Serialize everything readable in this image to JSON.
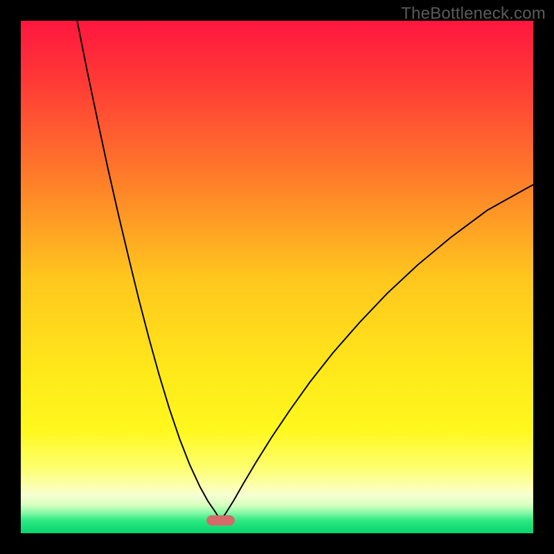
{
  "watermark": "TheBottleneck.com",
  "chart_data": {
    "type": "line",
    "title": "",
    "xlabel": "",
    "ylabel": "",
    "xlim": [
      0,
      1
    ],
    "ylim": [
      0,
      1
    ],
    "background_gradient": {
      "stops": [
        {
          "offset": 0.0,
          "color": "#ff163f"
        },
        {
          "offset": 0.12,
          "color": "#ff3a36"
        },
        {
          "offset": 0.3,
          "color": "#ff7a2a"
        },
        {
          "offset": 0.5,
          "color": "#ffc61e"
        },
        {
          "offset": 0.68,
          "color": "#ffe81a"
        },
        {
          "offset": 0.8,
          "color": "#fff81e"
        },
        {
          "offset": 0.87,
          "color": "#fdff6a"
        },
        {
          "offset": 0.905,
          "color": "#fcffa8"
        },
        {
          "offset": 0.925,
          "color": "#f7ffd2"
        },
        {
          "offset": 0.945,
          "color": "#d7ffbf"
        },
        {
          "offset": 0.962,
          "color": "#7cf7a3"
        },
        {
          "offset": 0.975,
          "color": "#2de983"
        },
        {
          "offset": 1.0,
          "color": "#07d46e"
        }
      ]
    },
    "curve": {
      "dip_x": 0.39,
      "left_start_x": 0.11,
      "left_start_y": 1.0,
      "right_end_x": 1.0,
      "right_end_y": 0.68,
      "floor_y": 0.025,
      "stroke": "#000000",
      "stroke_width": 2.0,
      "x": [
        0.11,
        0.13,
        0.15,
        0.17,
        0.19,
        0.21,
        0.23,
        0.25,
        0.27,
        0.29,
        0.31,
        0.33,
        0.35,
        0.365,
        0.38,
        0.39,
        0.4,
        0.415,
        0.435,
        0.46,
        0.49,
        0.525,
        0.565,
        0.61,
        0.66,
        0.715,
        0.775,
        0.84,
        0.91,
        0.985,
        1.0
      ],
      "y": [
        1.0,
        0.9,
        0.805,
        0.712,
        0.624,
        0.54,
        0.458,
        0.381,
        0.309,
        0.243,
        0.184,
        0.133,
        0.09,
        0.063,
        0.041,
        0.025,
        0.039,
        0.063,
        0.098,
        0.14,
        0.188,
        0.24,
        0.296,
        0.353,
        0.41,
        0.468,
        0.524,
        0.578,
        0.63,
        0.672,
        0.68
      ]
    },
    "marker": {
      "shape": "rounded-rect",
      "cx": 0.39,
      "cy": 0.025,
      "w": 0.055,
      "h": 0.02,
      "rx": 0.01,
      "fill": "#d46a6a"
    }
  }
}
